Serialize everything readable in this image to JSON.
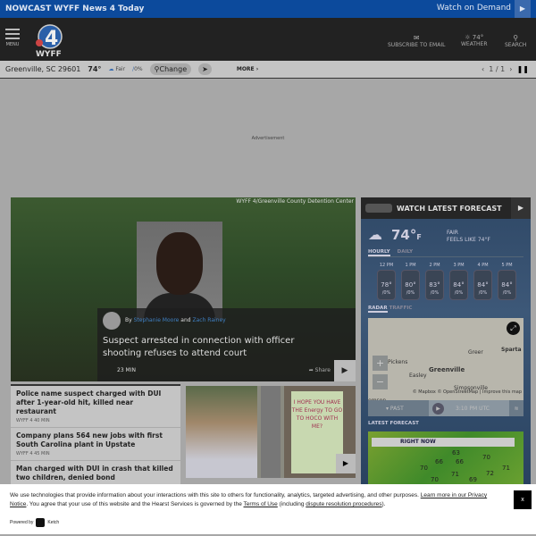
{
  "topbar": {
    "nowcast": "NOWCAST WYFF News 4 Today",
    "watch": "Watch on Demand"
  },
  "header": {
    "menu": "MENU",
    "logo_text": "WYFF",
    "logo_num": "4",
    "subscribe": "SUBSCRIBE TO EMAIL",
    "weather_temp": "74°",
    "weather": "WEATHER",
    "search": "SEARCH"
  },
  "wxbar": {
    "location": "Greenville, SC 29601",
    "temp": "74°",
    "cond": "Fair",
    "precip": "0%",
    "change": "Change",
    "more": "MORE",
    "pager": "1 / 1"
  },
  "ad": {
    "label": "Advertisement"
  },
  "hero": {
    "credit": "WYFF 4/Greenville County Detention Center",
    "by": "By",
    "author1": "Stephanie Moore",
    "and": "and",
    "author2": "Zach Rainey",
    "title": "Suspect arrested in connection with officer shooting refuses to attend court",
    "time": "23 MIN",
    "share": "Share"
  },
  "list": [
    {
      "title": "Police name suspect charged with DUI after 1-year-old hit, killed near restaurant",
      "meta": "WYFF 4 40 MIN"
    },
    {
      "title": "Company plans 564 new jobs with first South Carolina plant in Upstate",
      "meta": "WYFF 4 45 MIN"
    },
    {
      "title": "Man charged with DUI in crash that killed two children, denied bond",
      "meta": ""
    }
  ],
  "card": {
    "sign": "I HOPE YOU HAVE THE Energy TO GO TO HOCO WITH ME?"
  },
  "weather": {
    "header": "WATCH LATEST FORECAST",
    "temp": "74°",
    "unit": "F",
    "cond": "FAIR",
    "feels": "FEELS LIKE 74°F",
    "tab_hourly": "HOURLY",
    "tab_daily": "DAILY",
    "hours": [
      {
        "t": "12 PM",
        "v": "78°",
        "p": "0%"
      },
      {
        "t": "1 PM",
        "v": "80°",
        "p": "0%"
      },
      {
        "t": "2 PM",
        "v": "83°",
        "p": "0%"
      },
      {
        "t": "3 PM",
        "v": "84°",
        "p": "0%"
      },
      {
        "t": "4 PM",
        "v": "84°",
        "p": "0%"
      },
      {
        "t": "5 PM",
        "v": "84°",
        "p": "0%"
      }
    ],
    "tab_radar": "RADAR",
    "tab_traffic": "TRAFFIC",
    "map": {
      "greer": "Greer",
      "sparta": "Sparta",
      "pickens": "Pickens",
      "greenville": "Greenville",
      "easley": "Easley",
      "simpsonville": "Simpsonville",
      "clemson": "emson",
      "attribution": "© Mapbox © OpenStreetMap | Improve this map"
    },
    "past": "PAST",
    "time": "3:10 PM UTC",
    "latest": "LATEST FORECAST",
    "right_now": "RIGHT NOW",
    "nums": [
      "63",
      "66",
      "66",
      "70",
      "70",
      "71",
      "72",
      "71",
      "70",
      "69"
    ]
  },
  "cookie": {
    "text1": "We use technologies that provide information about your interactions with this site to others for functionality, analytics, targeted advertising, and other purposes.",
    "learn": "Learn more in our Privacy Notice",
    "text2": ". You agree that your use of this website and the Hearst Services is governed by the",
    "terms": "Terms of Use",
    "text3": "(including",
    "dispute": "dispute resolution procedures",
    "text4": ").",
    "close": "x",
    "powered": "Powered by",
    "ketch": "Ketch"
  }
}
